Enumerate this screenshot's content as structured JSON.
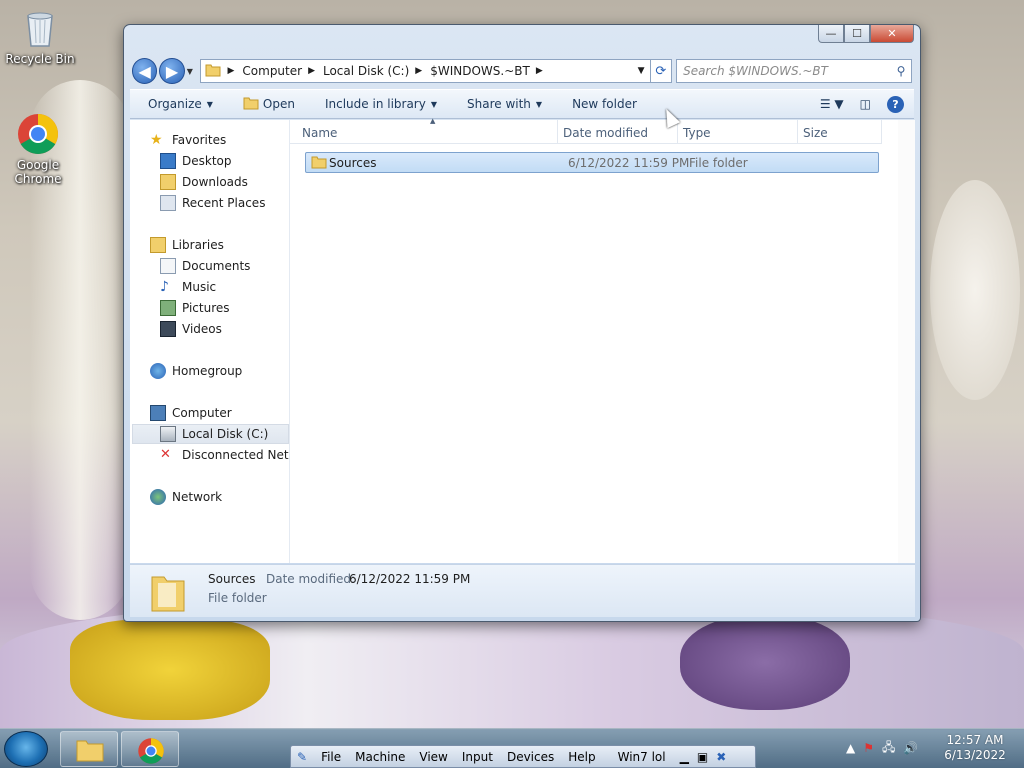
{
  "desktop": {
    "icons": [
      {
        "label": "Recycle Bin",
        "icon": "recycle-bin-icon"
      },
      {
        "label": "Google Chrome",
        "icon": "chrome-icon"
      }
    ]
  },
  "window": {
    "caption_buttons": {
      "minimize": "—",
      "maximize": "☐",
      "close": "✕"
    },
    "address": {
      "segments": [
        "Computer",
        "Local Disk (C:)",
        "$WINDOWS.~BT"
      ],
      "separator": "▶"
    },
    "search": {
      "placeholder": "Search $WINDOWS.~BT"
    },
    "toolbar": {
      "organize": "Organize",
      "open": "Open",
      "include_in_library": "Include in library",
      "share_with": "Share with",
      "new_folder": "New folder"
    },
    "nav": {
      "favorites": "Favorites",
      "desktop": "Desktop",
      "downloads": "Downloads",
      "recent_places": "Recent Places",
      "libraries": "Libraries",
      "documents": "Documents",
      "music": "Music",
      "pictures": "Pictures",
      "videos": "Videos",
      "homegroup": "Homegroup",
      "computer": "Computer",
      "local_disk": "Local Disk (C:)",
      "disconnected": "Disconnected Netwo",
      "network": "Network"
    },
    "columns": {
      "name": "Name",
      "date_modified": "Date modified",
      "type": "Type",
      "size": "Size"
    },
    "files": [
      {
        "name": "Sources",
        "date_modified": "6/12/2022 11:59 PM",
        "type": "File folder",
        "size": ""
      }
    ],
    "details": {
      "name": "Sources",
      "date_label": "Date modified:",
      "date_value": "6/12/2022 11:59 PM",
      "type": "File folder"
    }
  },
  "vbox_menu": {
    "file": "File",
    "machine": "Machine",
    "view": "View",
    "input": "Input",
    "devices": "Devices",
    "help": "Help",
    "vm_name": "Win7 lol"
  },
  "clock": {
    "time": "12:57 AM",
    "date": "6/13/2022"
  },
  "colors": {
    "selection": "#cce4fb",
    "accent": "#2a62b6",
    "toolbar_text": "#1e395b"
  }
}
